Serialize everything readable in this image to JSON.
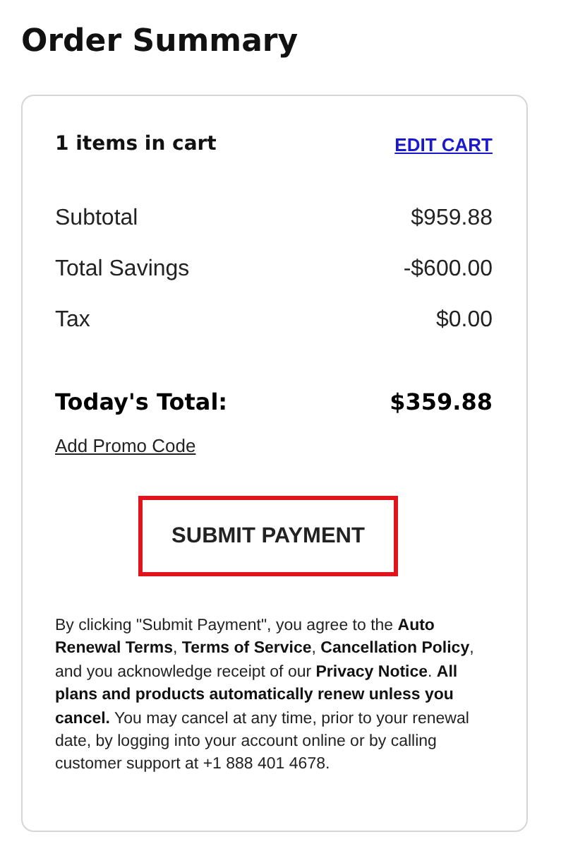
{
  "title": "Order Summary",
  "cart": {
    "count_label": "1 items in cart",
    "edit_link": "EDIT CART"
  },
  "lines": [
    {
      "label": "Subtotal",
      "amount": "$959.88"
    },
    {
      "label": "Total Savings",
      "amount": "-$600.00"
    },
    {
      "label": "Tax",
      "amount": "$0.00"
    }
  ],
  "total": {
    "label": "Today's Total:",
    "amount": "$359.88"
  },
  "promo_link": "Add Promo Code",
  "submit_button": "SUBMIT PAYMENT",
  "legal": "By clicking \"Submit Payment\", you agree to the **Auto Renewal Terms**, **Terms of Service**, **Cancellation Policy**, and you acknowledge receipt of our **Privacy Notice**. **All plans and products automatically renew unless you cancel.** You may cancel at any time, prior to your renewal date, by logging into your account online or by calling customer support at +1 888 401 4678."
}
